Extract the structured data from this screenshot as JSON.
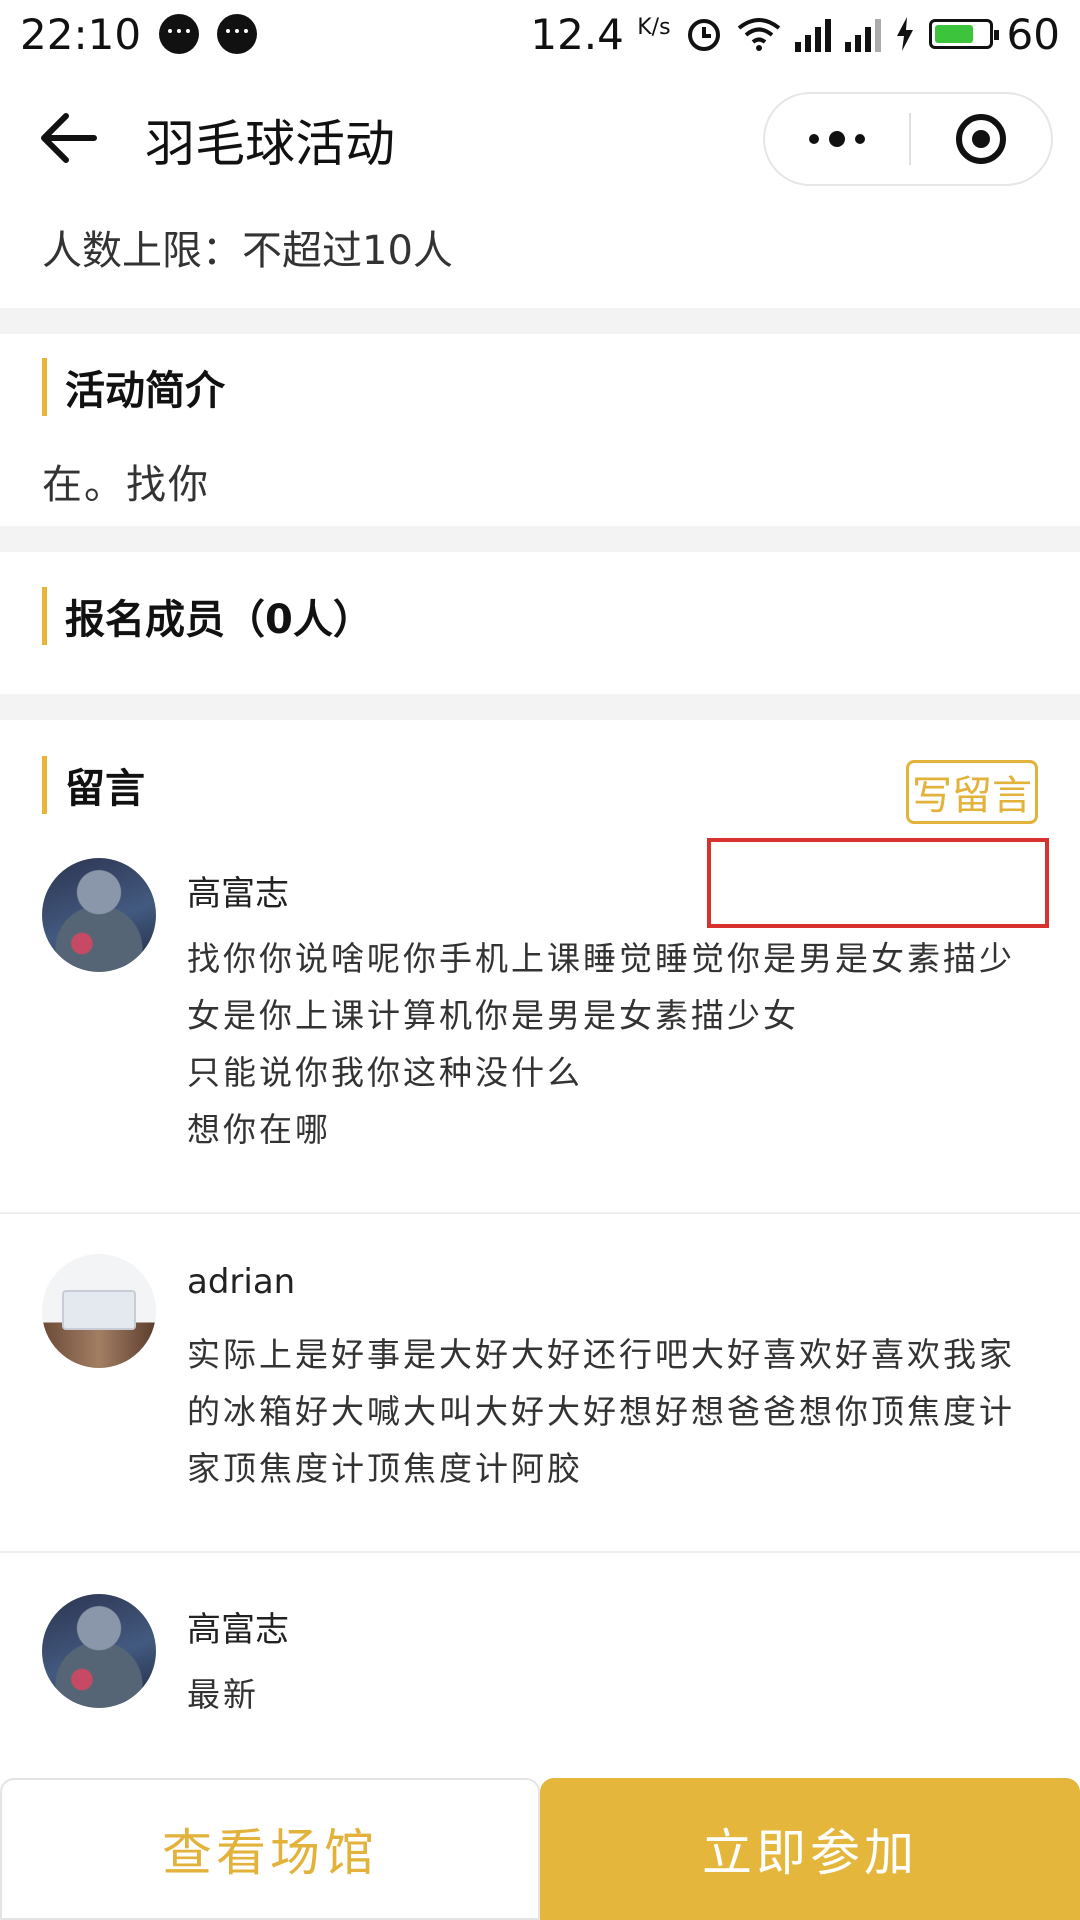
{
  "status_bar": {
    "time": "22:10",
    "net_speed": "12.4",
    "net_unit": "K/s",
    "net_3g": "3G",
    "net_4g": "4G",
    "battery": "60"
  },
  "nav": {
    "title": "羽毛球活动"
  },
  "info": {
    "limit_text": "人数上限：不超过10人"
  },
  "intro": {
    "title": "活动简介",
    "text": "在。找你"
  },
  "members": {
    "title": "报名成员（0人）"
  },
  "comments": {
    "title": "留言",
    "write_label": "写留言",
    "items": [
      {
        "name": "高富志",
        "text": "找你你说啥呢你手机上课睡觉睡觉你是男是女素描少女是你上课计算机你是男是女素描少女\n只能说你我你这种没什么\n想你在哪"
      },
      {
        "name": "adrian",
        "text": "实际上是好事是大好大好还行吧大好喜欢好喜欢我家的冰箱好大喊大叫大好大好想好想爸爸想你顶焦度计家顶焦度计顶焦度计阿胶"
      },
      {
        "name": "高富志",
        "text": "最新"
      }
    ]
  },
  "bottom": {
    "venue_label": "查看场馆",
    "join_label": "立即参加"
  },
  "colors": {
    "accent": "#e4b63c",
    "highlight": "#d8322f",
    "battery_green": "#3cc43c"
  }
}
